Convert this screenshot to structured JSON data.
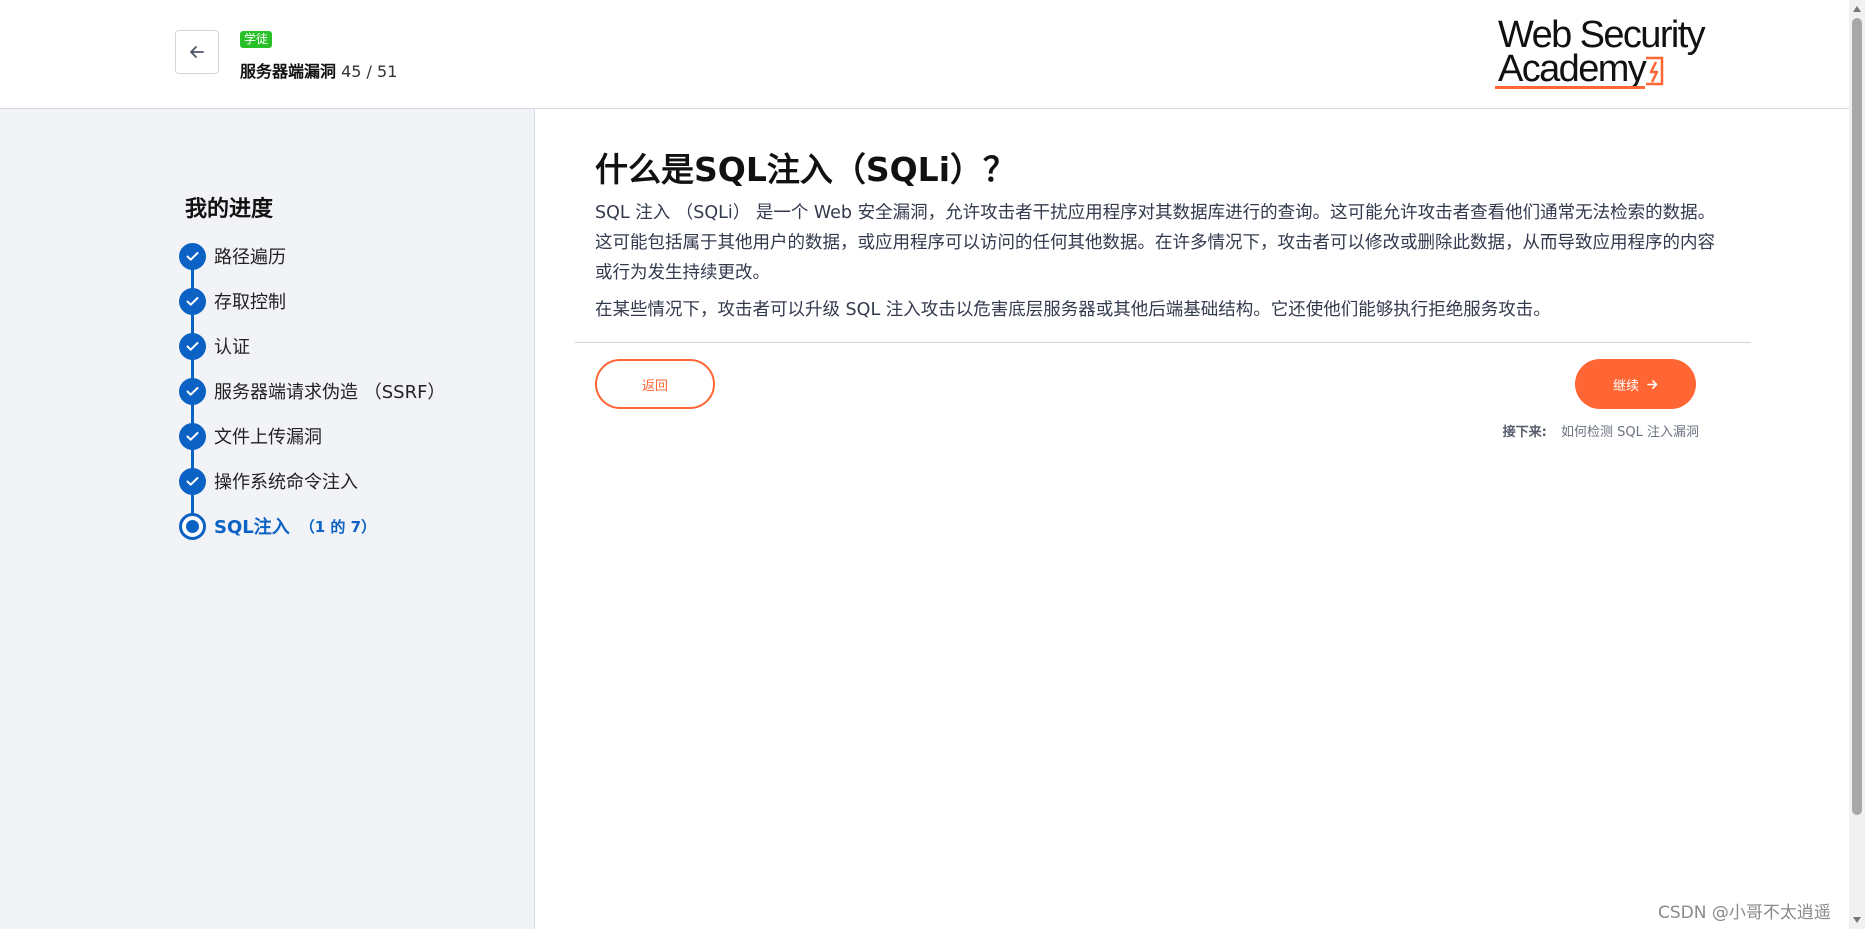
{
  "header": {
    "badge": "学徒",
    "topic": "服务器端漏洞",
    "count": "45 / 51",
    "logo_line1": "Web Security",
    "logo_line2": "Academy"
  },
  "sidebar": {
    "title": "我的进度",
    "steps": [
      {
        "label": "路径遍历",
        "status": "done"
      },
      {
        "label": "存取控制",
        "status": "done"
      },
      {
        "label": "认证",
        "status": "done"
      },
      {
        "label": "服务器端请求伪造 （SSRF）",
        "status": "done"
      },
      {
        "label": "文件上传漏洞",
        "status": "done"
      },
      {
        "label": "操作系统命令注入",
        "status": "done"
      },
      {
        "label": "SQL注入",
        "status": "current",
        "sub": "（1 的 7）"
      }
    ]
  },
  "main": {
    "title": "什么是SQL注入（SQLi）？",
    "para1": "SQL 注入 （SQLi） 是一个 Web 安全漏洞，允许攻击者干扰应用程序对其数据库进行的查询。这可能允许攻击者查看他们通常无法检索的数据。这可能包括属于其他用户的数据，或应用程序可以访问的任何其他数据。在许多情况下，攻击者可以修改或删除此数据，从而导致应用程序的内容或行为发生持续更改。",
    "para2": "在某些情况下，攻击者可以升级 SQL 注入攻击以危害底层服务器或其他后端基础结构。它还使他们能够执行拒绝服务攻击。",
    "back_label": "返回",
    "continue_label": "继续",
    "next_label": "接下来:",
    "next_link": "如何检测 SQL 注入漏洞"
  },
  "watermark": "CSDN @小哥不太逍遥",
  "colors": {
    "accent": "#ff6633",
    "progress_blue": "#0b62c4",
    "badge_green": "#27c127",
    "sidebar_bg": "#f1f3f7"
  },
  "icons": {
    "back": "arrow-left-icon",
    "done_step": "check-icon",
    "continue": "arrow-right-icon",
    "logo_mark": "lightning-bolt-icon"
  }
}
